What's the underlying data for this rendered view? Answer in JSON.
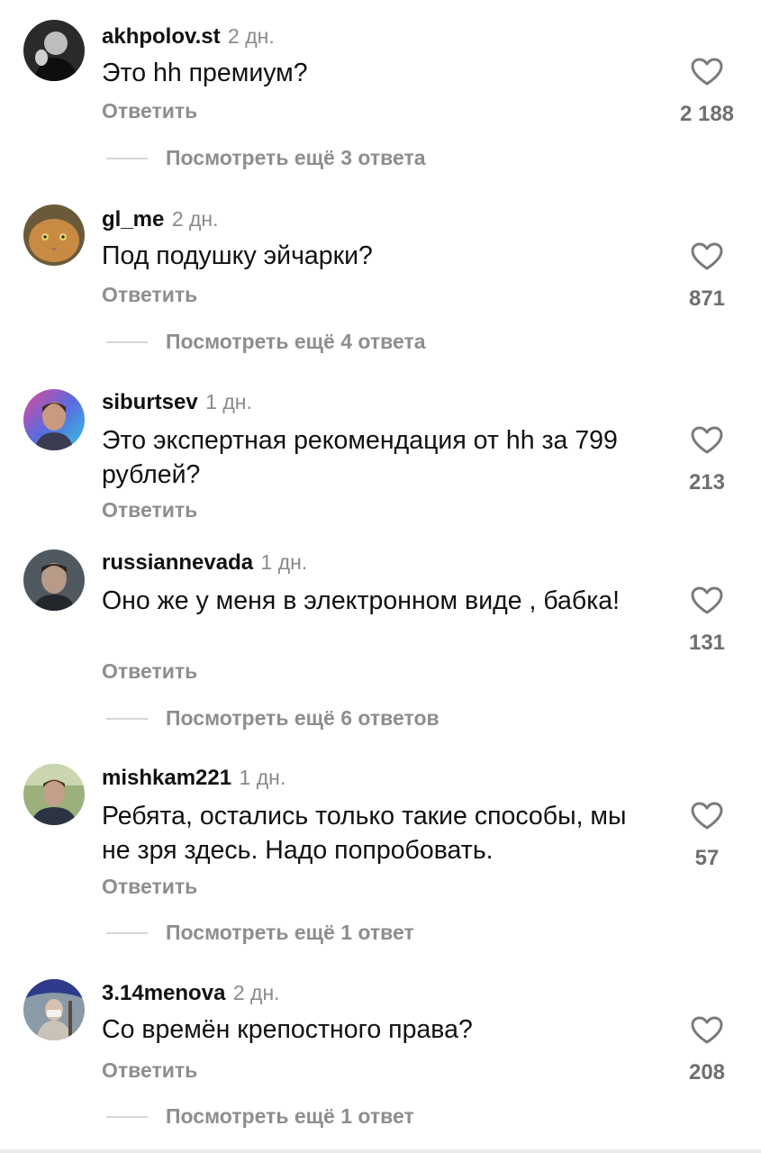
{
  "comments": [
    {
      "username": "akhpolov.st",
      "time": "2 дн.",
      "text": "Это hh премиум?",
      "reply_label": "Ответить",
      "likes": "2 188",
      "more_replies": "Посмотреть ещё 3 ответа"
    },
    {
      "username": "gl_me",
      "time": "2 дн.",
      "text": "Под подушку эйчарки?",
      "reply_label": "Ответить",
      "likes": "871",
      "more_replies": "Посмотреть ещё 4 ответа"
    },
    {
      "username": "siburtsev",
      "time": "1 дн.",
      "text": "Это экспертная рекомендация от hh за 799 рублей?",
      "reply_label": "Ответить",
      "likes": "213"
    },
    {
      "username": "russiannevada",
      "time": "1 дн.",
      "text": "Оно же у меня в электронном виде , бабка!",
      "reply_label": "Ответить",
      "likes": "131",
      "more_replies": "Посмотреть ещё 6 ответов"
    },
    {
      "username": "mishkam221",
      "time": "1 дн.",
      "text": "Ребята, остались только такие способы, мы не зря здесь. Надо попробовать.",
      "reply_label": "Ответить",
      "likes": "57",
      "more_replies": "Посмотреть ещё 1 ответ"
    },
    {
      "username": "3.14menova",
      "time": "2 дн.",
      "text": "Со времён крепостного права?",
      "reply_label": "Ответить",
      "likes": "208",
      "more_replies": "Посмотреть ещё 1 ответ"
    }
  ],
  "icons": {
    "like": "heart-outline-icon"
  },
  "colors": {
    "text": "#111111",
    "secondary": "#8e8e8e",
    "like_count": "#6f6f6f"
  }
}
